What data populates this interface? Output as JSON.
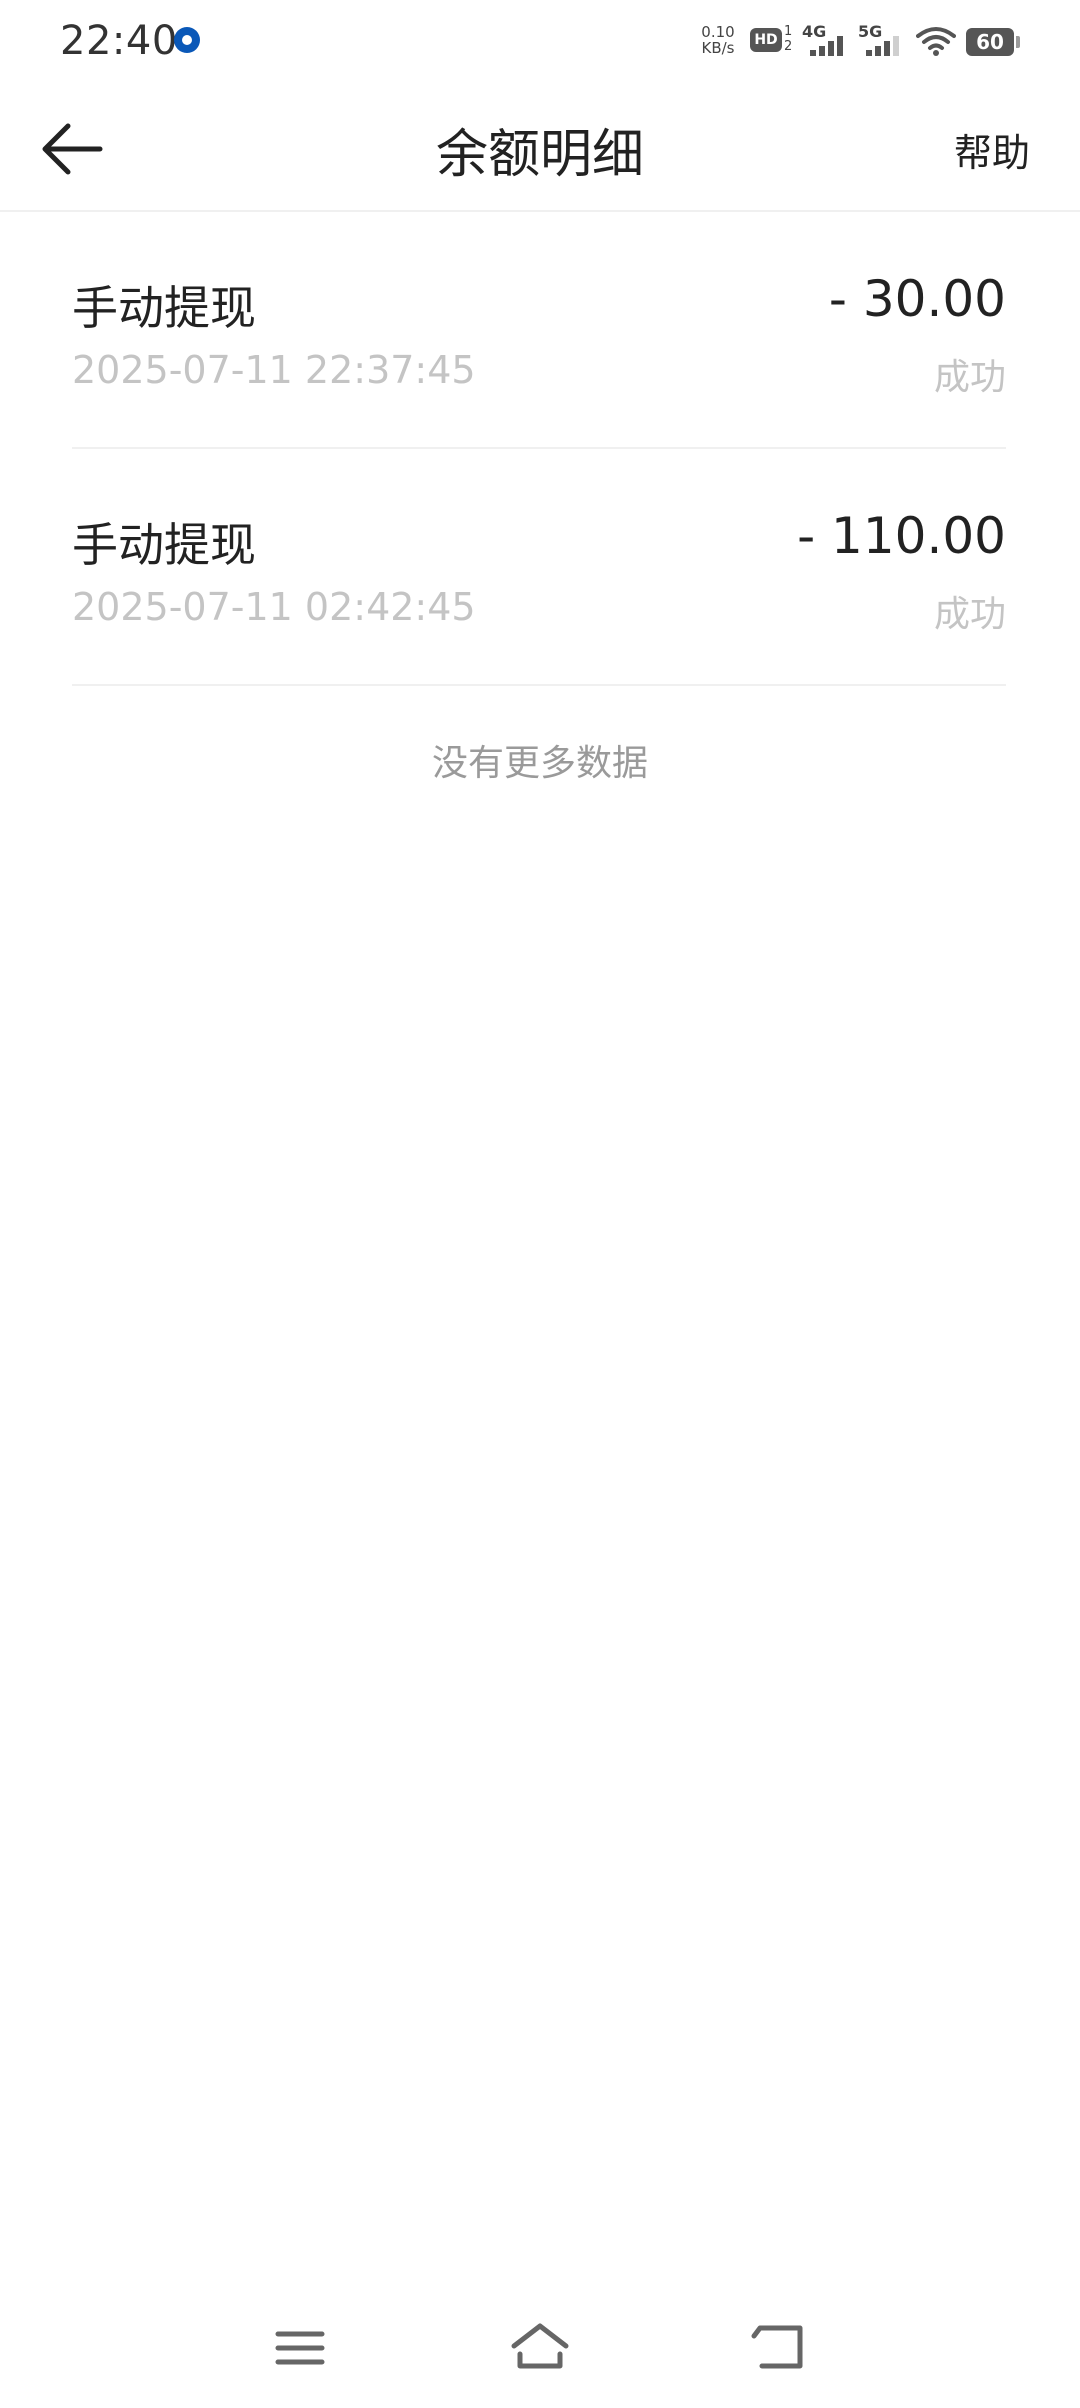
{
  "status_bar": {
    "time": "22:40",
    "net_speed_value": "0.10",
    "net_speed_unit": "KB/s",
    "hd_label": "HD",
    "hd_sim_top": "1",
    "hd_sim_bottom": "2",
    "network_1": "4G",
    "network_2": "5G",
    "battery_level": "60"
  },
  "header": {
    "title": "余额明细",
    "help_label": "帮助"
  },
  "records": [
    {
      "title": "手动提现",
      "amount": "- 30.00",
      "time": "2025-07-11 22:37:45",
      "status": "成功"
    },
    {
      "title": "手动提现",
      "amount": "- 110.00",
      "time": "2025-07-11 02:42:45",
      "status": "成功"
    }
  ],
  "footer_text": "没有更多数据",
  "nav_bar": {
    "icons": [
      "menu-icon",
      "home-icon",
      "back-icon"
    ]
  },
  "colors": {
    "text_primary": "#222222",
    "text_secondary": "#c4c4c4",
    "text_hint": "#9a9a9a",
    "divider": "#f0f0f0"
  }
}
